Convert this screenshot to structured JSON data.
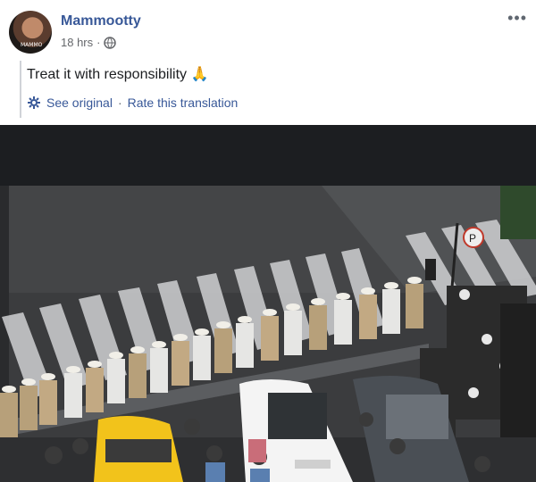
{
  "post": {
    "author": "Mammootty",
    "time": "18 hrs",
    "separator": "·",
    "privacy_icon": "globe-icon",
    "more_icon": "more-options-icon",
    "more_glyph": "•••",
    "text": "Treat it with responsibility",
    "emoji": "🙏",
    "avatar_badge": "MAMMO"
  },
  "translation": {
    "icon": "gear-icon",
    "see_original": "See original",
    "separator": "·",
    "rate": "Rate this translation"
  },
  "photo": {
    "description_icon": "police-line-photo",
    "sign_text": "P"
  },
  "colors": {
    "link": "#385898",
    "meta": "#65676b",
    "text": "#1c1e21"
  }
}
